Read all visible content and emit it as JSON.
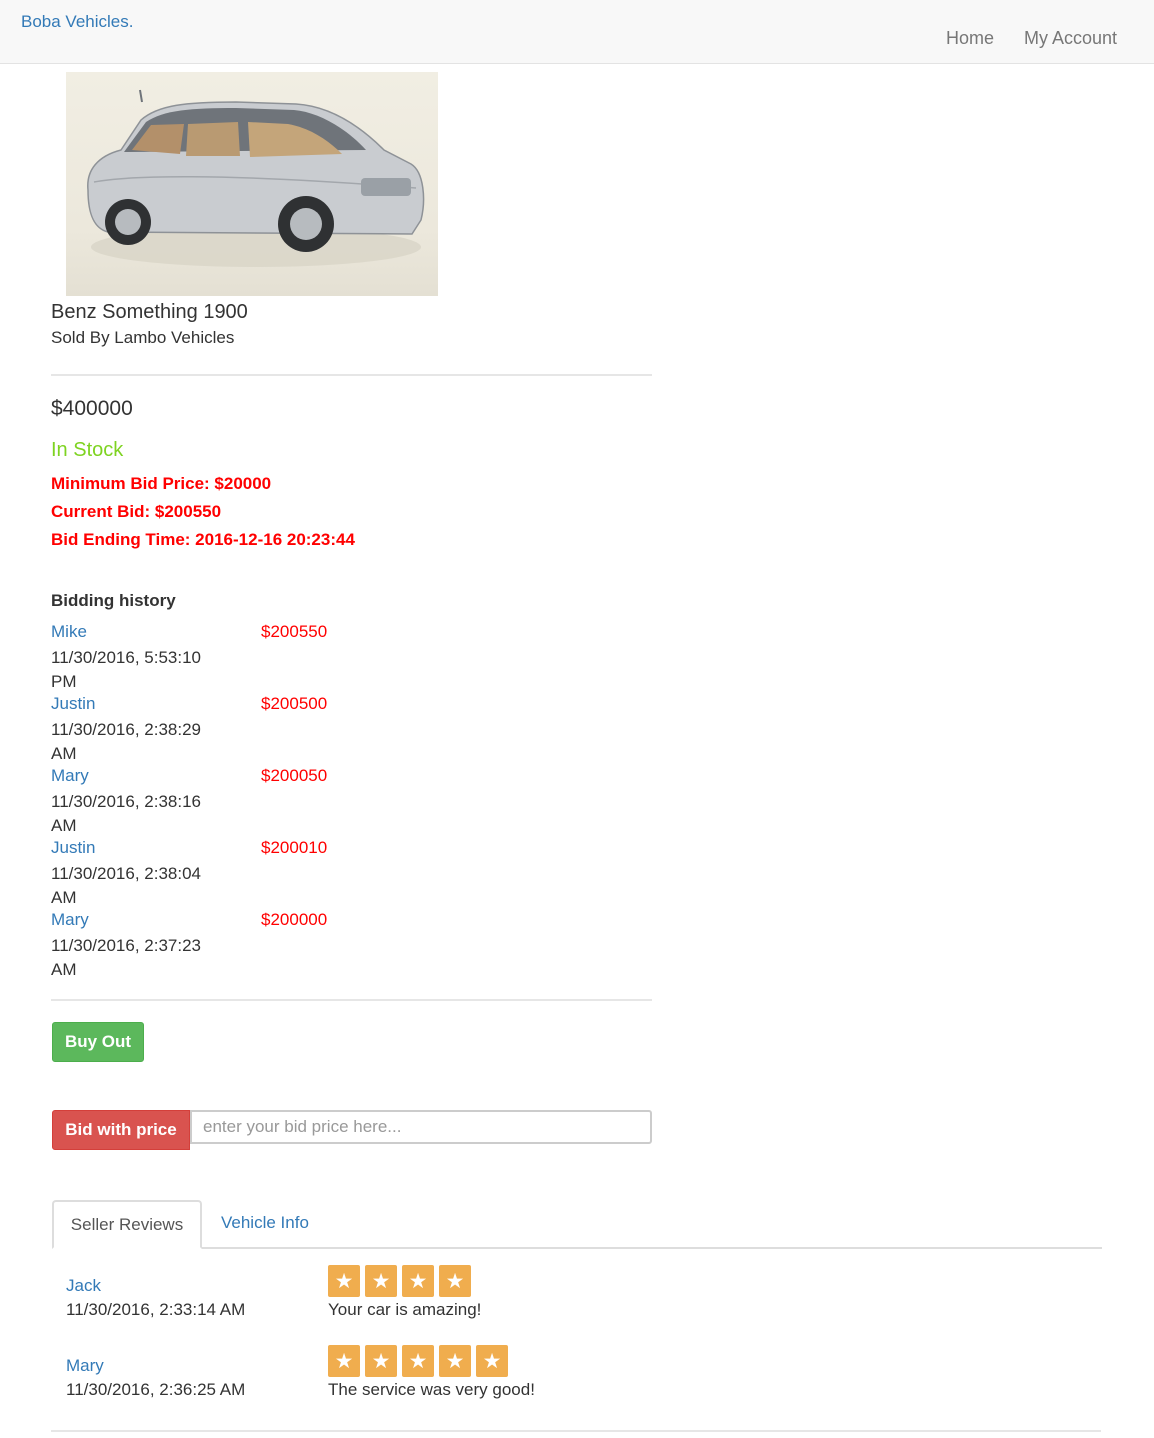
{
  "navbar": {
    "brand": "Boba Vehicles.",
    "links": [
      "Home",
      "My Account"
    ]
  },
  "product": {
    "image_alt": "silver hatchback car",
    "title": "Benz Something 1900",
    "seller": "Sold By Lambo Vehicles",
    "price": "$400000",
    "stock": "In Stock",
    "min_bid": "Minimum Bid Price: $20000",
    "current_bid": "Current Bid: $200550",
    "bid_end": "Bid Ending Time: 2016-12-16 20:23:44"
  },
  "colors": {
    "link": "#337ab7",
    "alert": "#ff0000",
    "stock": "#7ed321",
    "buy": "#5cb85c",
    "bid": "#d9534f",
    "star": "#f0ad4e"
  },
  "history": {
    "title": "Bidding history",
    "rows": [
      {
        "name": "Mike",
        "time": "11/30/2016, 5:53:10 PM",
        "amount": "$200550"
      },
      {
        "name": "Justin",
        "time": "11/30/2016, 2:38:29 AM",
        "amount": "$200500"
      },
      {
        "name": "Mary",
        "time": "11/30/2016, 2:38:16 AM",
        "amount": "$200050"
      },
      {
        "name": "Justin",
        "time": "11/30/2016, 2:38:04 AM",
        "amount": "$200010"
      },
      {
        "name": "Mary",
        "time": "11/30/2016, 2:37:23 AM",
        "amount": "$200000"
      }
    ]
  },
  "actions": {
    "buy_out": "Buy Out",
    "bid_button": "Bid with price",
    "bid_placeholder": "enter your bid price here..."
  },
  "tabs": [
    "Seller Reviews",
    "Vehicle Info"
  ],
  "reviews": [
    {
      "name": "Jack",
      "time": "11/30/2016, 2:33:14 AM",
      "rating": 4,
      "text": "Your car is amazing!"
    },
    {
      "name": "Mary",
      "time": "11/30/2016, 2:36:25 AM",
      "rating": 5,
      "text": "The service was very good!"
    }
  ],
  "star_icon": "star-icon"
}
